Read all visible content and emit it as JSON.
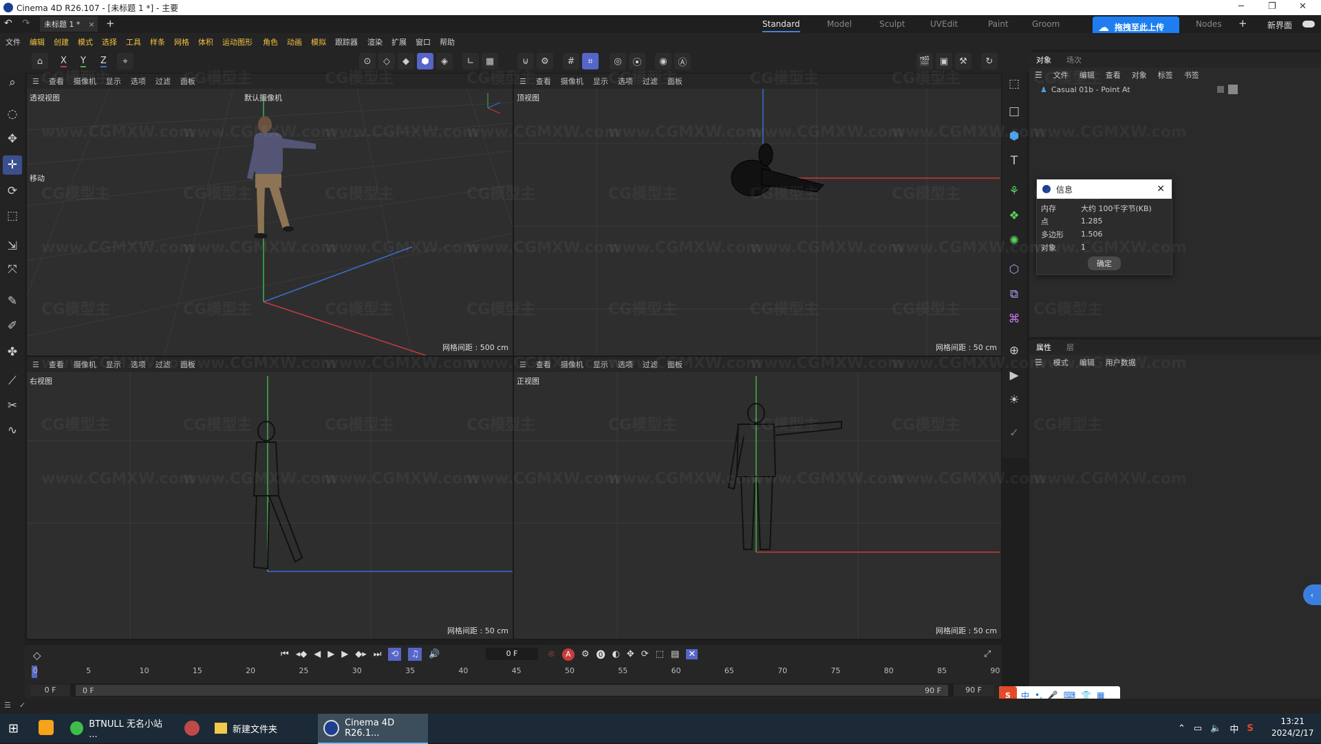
{
  "window": {
    "title": "Cinema 4D R26.107 - [未标题 1 *] - 主要"
  },
  "tabs": {
    "doc_tab": "未标题 1 *",
    "new_tab": "+",
    "close": "×"
  },
  "layouts": {
    "items": [
      "Standard",
      "Model",
      "Sculpt",
      "UVEdit",
      "Paint",
      "Groom",
      "Nodes"
    ],
    "active": "Standard",
    "new_layout": "新界面",
    "add": "+"
  },
  "upload_button": {
    "label": "拖拽至此上传",
    "color": "#1e7ef0"
  },
  "menu": {
    "items": [
      "文件",
      "编辑",
      "创建",
      "模式",
      "选择",
      "工具",
      "样条",
      "网格",
      "体积",
      "运动图形",
      "角色",
      "动画",
      "模拟",
      "跟踪器",
      "渲染",
      "扩展",
      "窗口",
      "帮助"
    ]
  },
  "toolbar": {
    "axis_x": "X",
    "axis_y": "Y",
    "axis_z": "Z"
  },
  "viewport_menu": {
    "items": [
      "查看",
      "摄像机",
      "显示",
      "选项",
      "过滤",
      "面板"
    ]
  },
  "viewports": {
    "persp": {
      "name": "透视视图",
      "camera": "默认摄像机",
      "grid": "网格间距 : 500 cm",
      "tool_label": "移动"
    },
    "top": {
      "name": "顶视图",
      "grid": "网格间距 : 50 cm"
    },
    "right": {
      "name": "右视图",
      "grid": "网格间距 : 50 cm"
    },
    "front": {
      "name": "正视图",
      "grid": "网格间距 : 50 cm"
    }
  },
  "object_panel": {
    "tabs": [
      "对象",
      "场次"
    ],
    "menu": [
      "文件",
      "编辑",
      "查看",
      "对象",
      "标签",
      "书签"
    ],
    "object_name": "Casual 01b - Point At"
  },
  "info_dialog": {
    "title": "信息",
    "rows": [
      {
        "key": "内存",
        "value": "大约 100千字节(KB)"
      },
      {
        "key": "点",
        "value": "1.285"
      },
      {
        "key": "多边形",
        "value": "1.506"
      },
      {
        "key": "对象",
        "value": "1"
      }
    ],
    "ok": "确定"
  },
  "attr_panel": {
    "tabs": [
      "属性",
      "层"
    ],
    "menu": [
      "模式",
      "编辑",
      "用户数据"
    ]
  },
  "timeline": {
    "current_frame": "0 F",
    "ticks": [
      "0",
      "5",
      "10",
      "15",
      "20",
      "25",
      "30",
      "35",
      "40",
      "45",
      "50",
      "55",
      "60",
      "65",
      "70",
      "75",
      "80",
      "85",
      "90"
    ],
    "start": "0 F",
    "start2": "0 F",
    "end": "90 F",
    "end2": "90 F"
  },
  "ime": {
    "items": [
      "中",
      "•,",
      "🎤",
      "⌨",
      "👕",
      "▦"
    ]
  },
  "taskbar": {
    "items": [
      "BTNULL 无名小站 ...",
      "新建文件夹",
      "Cinema 4D R26.1..."
    ],
    "time": "13:21",
    "date": "2024/2/17",
    "ime_lang": "中"
  },
  "watermark": "CG模型主",
  "watermark_url": "www.CGMXW.com",
  "colors": {
    "accent": "#4d7fd9",
    "axis_x": "#c83c3c",
    "axis_y": "#3cb44b",
    "axis_z": "#3c6fd0"
  }
}
